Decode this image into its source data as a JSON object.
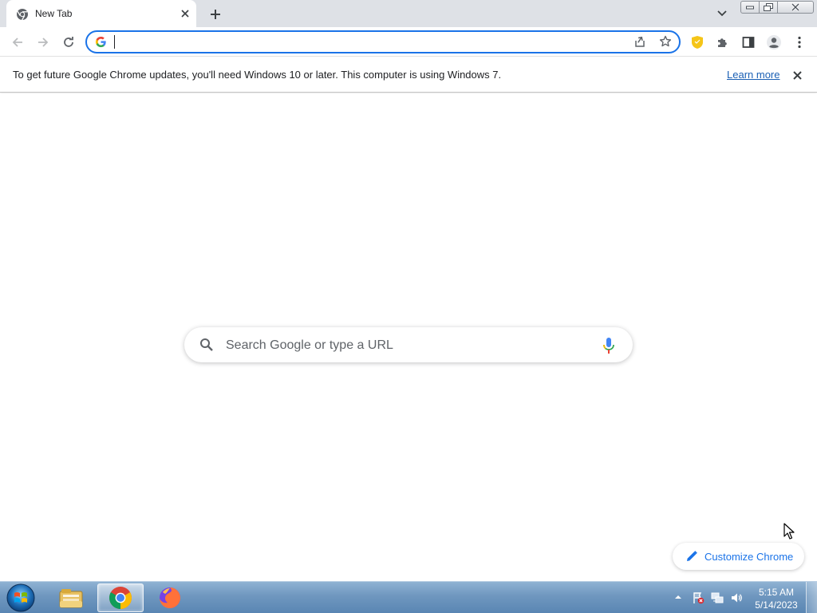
{
  "browser": {
    "tab": {
      "title": "New Tab"
    },
    "omnibox": {
      "value": "",
      "placeholder": ""
    },
    "infobar": {
      "message": "To get future Google Chrome updates, you'll need Windows 10 or later. This computer is using Windows 7.",
      "learn_more": "Learn more"
    }
  },
  "ntp": {
    "search_placeholder": "Search Google or type a URL",
    "customize_label": "Customize Chrome"
  },
  "taskbar": {
    "apps": [
      "windows-explorer",
      "google-chrome",
      "firefox"
    ],
    "active_app": "google-chrome",
    "clock": {
      "time": "5:15 AM",
      "date": "5/14/2023"
    }
  },
  "colors": {
    "accent": "#1a73e8",
    "tabstrip": "#dee1e6",
    "taskbar": "#6f97bf"
  }
}
